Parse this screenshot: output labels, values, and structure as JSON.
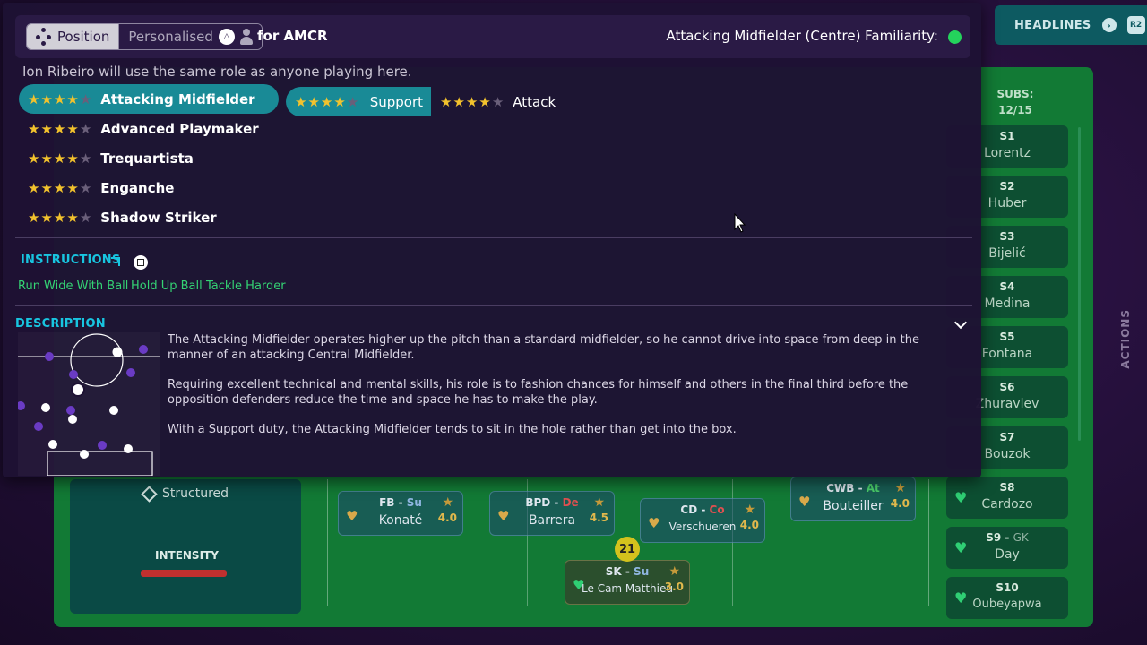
{
  "header": {
    "headlines_label": "HEADLINES",
    "headlines_button": "R2"
  },
  "panel": {
    "tab_position": "Position",
    "tab_personalised": "Personalised",
    "for_label": "for AMCR",
    "familiarity_label": "Attacking Midfielder (Centre) Familiarity:",
    "familiarity_color": "#24d35c",
    "note": "Ion Ribeiro will use the same role as anyone playing here.",
    "roles": [
      {
        "name": "Attacking Midfielder",
        "stars": 4,
        "selected": true
      },
      {
        "name": "Advanced Playmaker",
        "stars": 4
      },
      {
        "name": "Trequartista",
        "stars": 4
      },
      {
        "name": "Enganche",
        "stars": 4
      },
      {
        "name": "Shadow Striker",
        "stars": 4
      }
    ],
    "duties": [
      {
        "name": "Support",
        "stars": 4,
        "selected": true
      },
      {
        "name": "Attack",
        "stars": 4
      }
    ],
    "instructions_title": "INSTRUCTIONS",
    "instructions": [
      "Run Wide With Ball",
      "Hold Up Ball",
      "Tackle Harder"
    ],
    "description_title": "DESCRIPTION",
    "description": [
      "The Attacking Midfielder operates higher up the pitch than a standard midfielder, so he cannot drive into space from deep in the manner of an attacking Central Midfielder.",
      "Requiring excellent technical and mental skills, his role is to fashion chances for himself and others in the final third before the opposition defenders reduce the time and space he has to make the play.",
      "With a Support duty, the Attacking Midfielder tends to sit in the hole rather than get into the box."
    ]
  },
  "tactics": {
    "mentality": "Structured",
    "intensity_label": "INTENSITY"
  },
  "players": [
    {
      "role": "FB",
      "duty": "Su",
      "name": "Konaté",
      "rating": "4.0"
    },
    {
      "role": "BPD",
      "duty": "De",
      "name": "Barrera",
      "rating": "4.5"
    },
    {
      "role": "CD",
      "duty": "Co",
      "name": "Verschueren",
      "rating": "4.0"
    },
    {
      "role": "CWB",
      "duty": "At",
      "name": "Bouteiller",
      "rating": "4.0"
    },
    {
      "role": "SK",
      "duty": "Su",
      "name": "Le Cam Matthieu",
      "rating": "3.0",
      "number": "21"
    }
  ],
  "subs": {
    "title": "SUBS:",
    "count": "12/15",
    "items": [
      {
        "code": "S1",
        "name": "Lorentz"
      },
      {
        "code": "S2",
        "name": "Huber"
      },
      {
        "code": "S3",
        "name": "Bijelić"
      },
      {
        "code": "S4",
        "name": "Medina"
      },
      {
        "code": "S5",
        "name": "Fontana"
      },
      {
        "code": "S6",
        "name": "Zhuravlev"
      },
      {
        "code": "S7",
        "name": "Bouzok"
      },
      {
        "code": "S8",
        "name": "Cardozo"
      },
      {
        "code": "S9",
        "pos": "GK",
        "name": "Day"
      },
      {
        "code": "S10",
        "name": "Oubeyapwa"
      }
    ]
  },
  "actions_label": "ACTIONS"
}
